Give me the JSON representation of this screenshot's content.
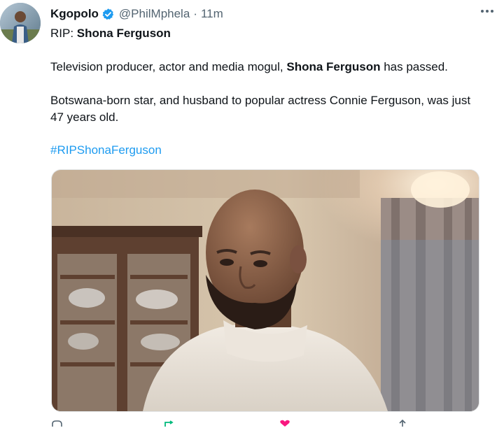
{
  "author": {
    "name": "Kgopolo",
    "handle": "@PhilMphela",
    "separator": "·",
    "time": "11m",
    "verified_color": "#1d9bf0",
    "avatar_icon": "profile-photo"
  },
  "tweet": {
    "line1_prefix": "RIP: ",
    "line1_bold": "Shona Ferguson",
    "p1_before": "Television producer, actor and media mogul, ",
    "p1_bold": "Shona Ferguson",
    "p1_after": " has passed.",
    "p2": "Botswana-born star, and husband to popular actress Connie Ferguson, was just 47 years old.",
    "hashtag": "#RIPShonaFerguson",
    "hashtag_color": "#1d9bf0"
  },
  "media": {
    "icon": "photo-man-white-turtleneck"
  },
  "actions": {
    "icons": [
      "reply-icon",
      "retweet-icon",
      "like-icon",
      "share-icon"
    ],
    "retweet_color": "#00ba7c",
    "like_color": "#f91880"
  }
}
